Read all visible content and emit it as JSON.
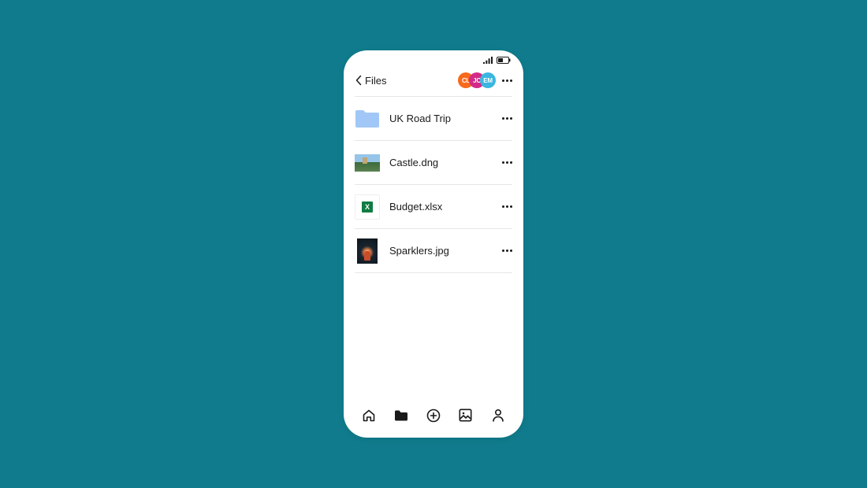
{
  "header": {
    "back_label": "Files"
  },
  "avatars": [
    {
      "initials": "CL",
      "color": "#f76a1c"
    },
    {
      "initials": "JC",
      "color": "#d32a87"
    },
    {
      "initials": "EM",
      "color": "#3ab6e0"
    }
  ],
  "files": [
    {
      "name": "UK Road Trip",
      "type": "folder"
    },
    {
      "name": "Castle.dng",
      "type": "image-castle"
    },
    {
      "name": "Budget.xlsx",
      "type": "xlsx"
    },
    {
      "name": "Sparklers.jpg",
      "type": "image-sparklers"
    }
  ],
  "nav": {
    "home": "home",
    "files": "files",
    "add": "add",
    "photos": "photos",
    "account": "account"
  }
}
